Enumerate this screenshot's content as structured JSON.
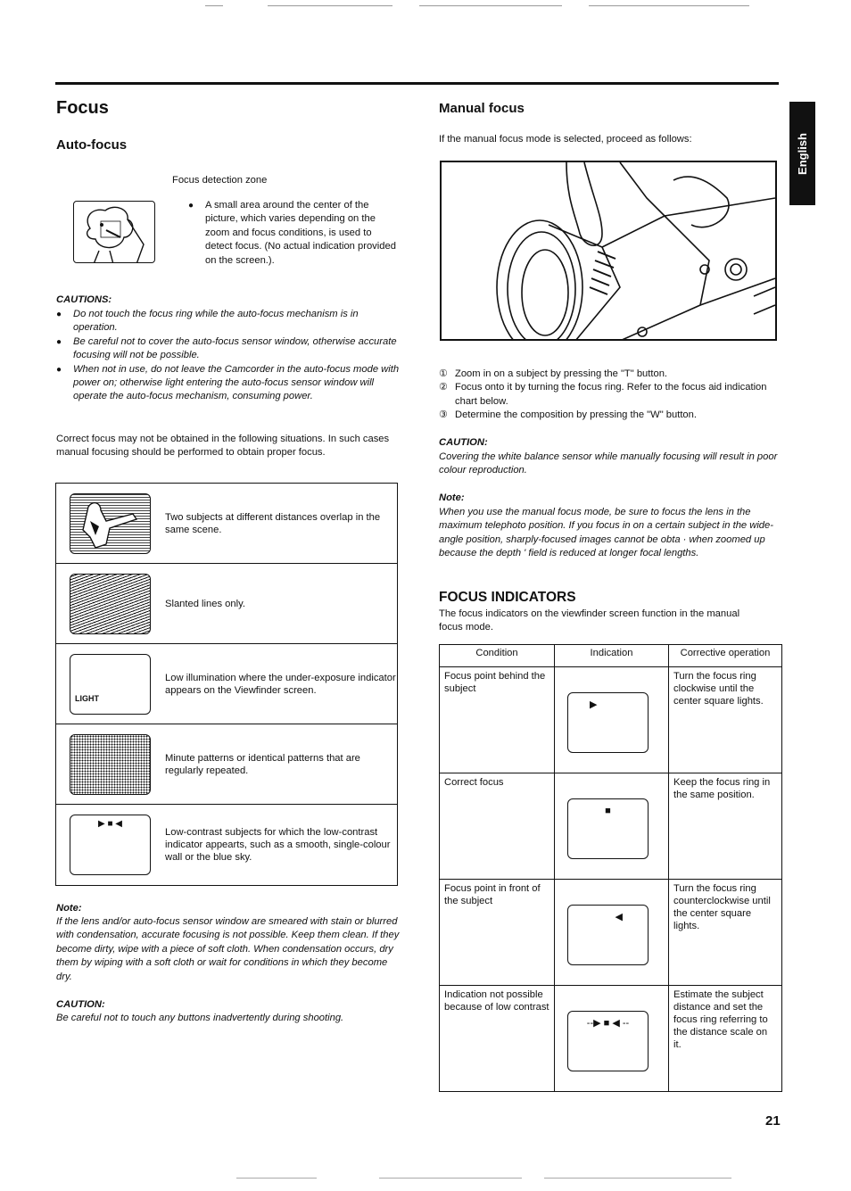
{
  "page": {
    "title": "Focus",
    "side_tab": "English",
    "page_number": "21"
  },
  "auto_focus": {
    "heading": "Auto-focus",
    "zone_label": "Focus detection zone",
    "zone_description": "A small area around the center of the picture, which varies depending on the zoom and focus conditions, is used to detect focus. (No actual indication provided on the screen.).",
    "cautions_heading": "CAUTIONS:",
    "cautions": [
      "Do not touch the focus ring while the auto-focus mechanism is in operation.",
      "Be careful not to cover the auto-focus sensor window, otherwise accurate focusing will not be possible.",
      "When not in use, do not leave the Camcorder in the auto-focus mode with power on; otherwise light entering the auto-focus sensor window will operate the auto-focus mechanism, consuming power."
    ],
    "intro": "Correct focus may not be obtained in the following situations. In such cases manual focusing should be performed to obtain proper focus.",
    "situations": [
      {
        "image": "overlapping-subjects-image",
        "text": "Two subjects at different distances overlap in the same scene."
      },
      {
        "image": "slanted-lines-image",
        "text": "Slanted lines only."
      },
      {
        "image": "low-light-viewfinder-image",
        "overlay": "LIGHT",
        "text": "Low illumination where the under-exposure indicator appears on the Viewfinder screen."
      },
      {
        "image": "minute-patterns-image",
        "text": "Minute patterns or identical patterns that are regularly repeated."
      },
      {
        "image": "low-contrast-viewfinder-image",
        "overlay": "▶ ■ ◀",
        "text": "Low-contrast subjects for which the low-contrast indicator appearts, such as a smooth, single-colour wall or the blue sky."
      }
    ],
    "note_heading": "Note:",
    "note": "If the lens and/or auto-focus sensor window are smeared with stain or blurred with condensation, accurate focusing is not possible. Keep them clean. If they become dirty, wipe with a piece of soft cloth. When condensation occurs, dry them by wiping with a soft cloth or wait for conditions in which they become dry.",
    "caution_heading": "CAUTION:",
    "caution": "Be careful not to touch any buttons inadvertently during shooting."
  },
  "manual_focus": {
    "heading": "Manual focus",
    "intro": "If the manual focus mode is selected, proceed as follows:",
    "steps": [
      {
        "num": "①",
        "text": "Zoom in on a subject by pressing the \"T\" button."
      },
      {
        "num": "②",
        "text": "Focus onto it by turning the focus ring. Refer to the focus aid indication chart below."
      },
      {
        "num": "③",
        "text": "Determine the composition by pressing the \"W\" button."
      }
    ],
    "caution_heading": "CAUTION:",
    "caution": "Covering the white balance sensor while manually focusing will result in poor colour reproduction.",
    "note_heading": "Note:",
    "note": "When you use the manual focus mode, be sure to focus the lens in the maximum telephoto position. If you focus in on a certain subject in the wide-angle position, sharply-focused images cannot be obta   · when zoomed up because the depth  ' field is reduced at longer focal lengths."
  },
  "focus_indicators": {
    "heading": "FOCUS INDICATORS",
    "intro": "The focus indicators on the viewfinder screen function in the manual focus mode.",
    "columns": [
      "Condition",
      "Indication",
      "Corrective operation"
    ],
    "rows": [
      {
        "condition": "Focus point behind the subject",
        "indication": "▶",
        "operation": "Turn the focus ring clockwise until the center square lights."
      },
      {
        "condition": "Correct focus",
        "indication": "■",
        "operation": "Keep the focus ring in the same position."
      },
      {
        "condition": "Focus point in front of the subject",
        "indication": "◀",
        "operation": "Turn the focus ring counterclockwise until the center square lights."
      },
      {
        "condition": "Indication not possible because of low contrast",
        "indication": "--▶ ■ ◀ --",
        "operation": "Estimate the subject distance and set the focus ring referring to the distance scale on it."
      }
    ]
  }
}
